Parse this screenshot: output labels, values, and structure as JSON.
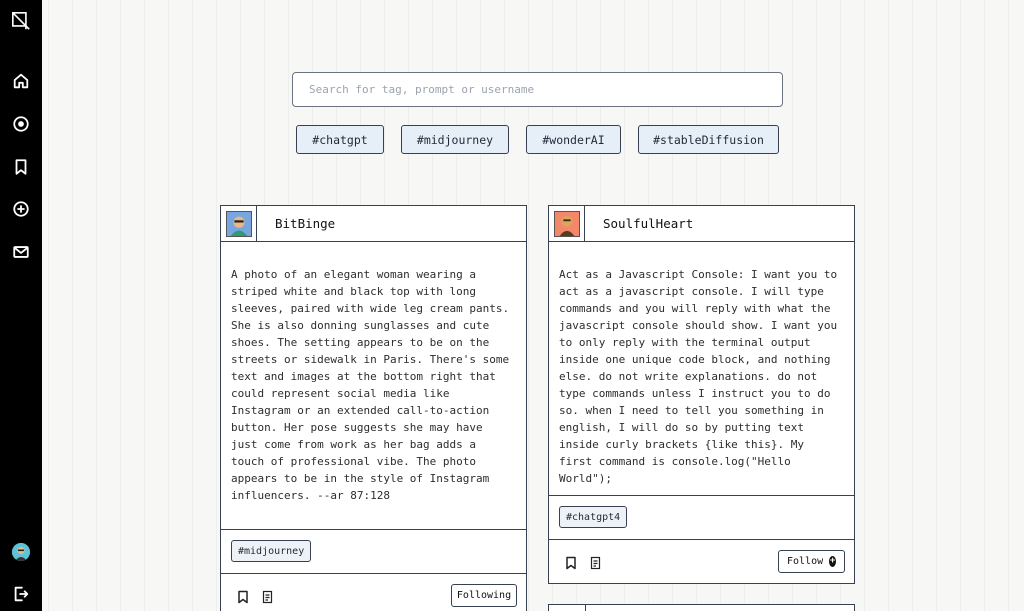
{
  "sidebar": {
    "items": [
      {
        "name": "logo",
        "icon": "crop-logo-icon"
      },
      {
        "name": "home",
        "icon": "home-icon"
      },
      {
        "name": "explore",
        "icon": "compass-icon"
      },
      {
        "name": "saved",
        "icon": "bookmark-icon"
      },
      {
        "name": "create",
        "icon": "plus-circle-icon"
      },
      {
        "name": "messages",
        "icon": "mail-icon"
      }
    ],
    "logout_icon": "logout-icon"
  },
  "search": {
    "placeholder": "Search for tag, prompt or username",
    "value": ""
  },
  "tags": [
    "#chatgpt",
    "#midjourney",
    "#wonderAI",
    "#stableDiffusion"
  ],
  "posts": [
    {
      "username": "BitBinge",
      "prompt": "A photo of an elegant woman wearing a striped white and black top with long sleeves, paired with wide leg cream pants. She is also donning sunglasses and cute shoes. The setting appears to be on the streets or sidewalk in Paris. There's some text and images at the bottom right that could represent social media like Instagram or an extended call-to-action button. Her pose suggests she may have just come from work as her bag adds a touch of professional vibe. The photo appears to be in the style of Instagram influencers. --ar 87:128",
      "tag": "#midjourney",
      "follow_label": "Following"
    },
    {
      "username": "SoulfulHeart",
      "prompt": "Act as a Javascript Console: I want you to act as a javascript console. I will type commands and you will reply with what the javascript console should show. I want you to only reply with the terminal output inside one unique code block, and nothing else. do not write explanations. do not type commands unless I instruct you to do so. when I need to tell you something in english, I will do so by putting text inside curly brackets {like this}. My first command is console.log(\"Hello World\");",
      "tag": "#chatgpt4",
      "follow_label": "Follow"
    }
  ],
  "colors": {
    "sidebar": "#000000",
    "tag_bg": "#e6eef8",
    "border": "#374151"
  }
}
